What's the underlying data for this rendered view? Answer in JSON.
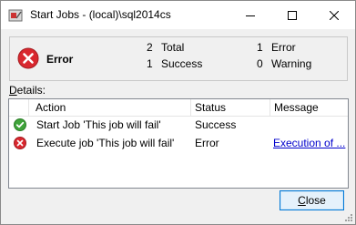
{
  "window": {
    "title": "Start Jobs - (local)\\sql2014cs",
    "icon": "tools-icon",
    "controls": {
      "minimize": "minimize-icon",
      "maximize": "maximize-icon",
      "close": "close-icon"
    }
  },
  "summary": {
    "status_label": "Error",
    "status_icon": "error-icon",
    "total_count": "2",
    "total_label": "Total",
    "success_count": "1",
    "success_label": "Success",
    "error_count": "1",
    "error_label": "Error",
    "warning_count": "0",
    "warning_label": "Warning"
  },
  "details": {
    "label_prefix": "D",
    "label_rest": "etails:",
    "columns": [
      "",
      "Action",
      "Status",
      "Message"
    ],
    "rows": [
      {
        "icon": "success-check-icon",
        "action": "Start Job 'This job will fail'",
        "status": "Success",
        "message": ""
      },
      {
        "icon": "error-icon",
        "action": "Execute job 'This job will fail'",
        "status": "Error",
        "message": "Execution of ..."
      }
    ]
  },
  "buttons": {
    "close_prefix": "C",
    "close_rest": "lose"
  },
  "colors": {
    "error": "#d9272e",
    "success": "#3fa33a",
    "link": "#0000cc",
    "focus_border": "#0078d7"
  }
}
